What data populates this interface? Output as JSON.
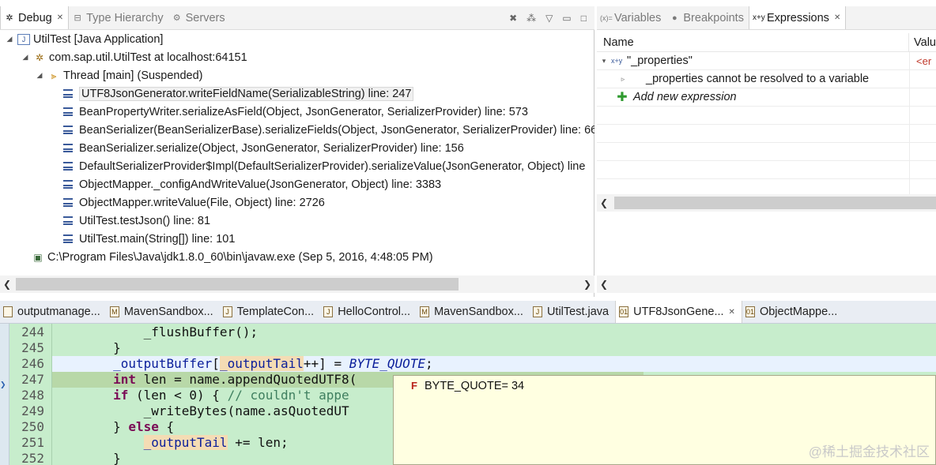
{
  "debug_view": {
    "tabs": [
      {
        "label": "Debug",
        "icon": "debug-bug-icon"
      },
      {
        "label": "Type Hierarchy",
        "icon": "type-hierarchy-icon"
      },
      {
        "label": "Servers",
        "icon": "servers-icon"
      }
    ],
    "tree": [
      {
        "label": "UtilTest [Java Application]",
        "level": 0,
        "icon": "java-application-icon",
        "expanded": true
      },
      {
        "label": "com.sap.util.UtilTest at localhost:64151",
        "level": 1,
        "icon": "debug-target-icon",
        "expanded": true
      },
      {
        "label": "Thread [main] (Suspended)",
        "level": 2,
        "icon": "suspended-thread-icon",
        "expanded": true
      },
      {
        "label": "UTF8JsonGenerator.writeFieldName(SerializableString) line: 247",
        "level": 3,
        "icon": "stack-frame-icon",
        "selected": true
      },
      {
        "label": "BeanPropertyWriter.serializeAsField(Object, JsonGenerator, SerializerProvider) line: 573",
        "level": 3,
        "icon": "stack-frame-icon"
      },
      {
        "label": "BeanSerializer(BeanSerializerBase).serializeFields(Object, JsonGenerator, SerializerProvider) line: 66",
        "level": 3,
        "icon": "stack-frame-icon"
      },
      {
        "label": "BeanSerializer.serialize(Object, JsonGenerator, SerializerProvider) line: 156",
        "level": 3,
        "icon": "stack-frame-icon"
      },
      {
        "label": "DefaultSerializerProvider$Impl(DefaultSerializerProvider).serializeValue(JsonGenerator, Object) line",
        "level": 3,
        "icon": "stack-frame-icon"
      },
      {
        "label": "ObjectMapper._configAndWriteValue(JsonGenerator, Object) line: 3383",
        "level": 3,
        "icon": "stack-frame-icon"
      },
      {
        "label": "ObjectMapper.writeValue(File, Object) line: 2726",
        "level": 3,
        "icon": "stack-frame-icon"
      },
      {
        "label": "UtilTest.testJson() line: 81",
        "level": 3,
        "icon": "stack-frame-icon"
      },
      {
        "label": "UtilTest.main(String[]) line: 101",
        "level": 3,
        "icon": "stack-frame-icon"
      },
      {
        "label": "C:\\Program Files\\Java\\jdk1.8.0_60\\bin\\javaw.exe (Sep 5, 2016, 4:48:05 PM)",
        "level": 1,
        "icon": "process-icon"
      }
    ]
  },
  "expr_view": {
    "tabs": [
      {
        "label": "Variables",
        "icon": "variables-icon"
      },
      {
        "label": "Breakpoints",
        "icon": "breakpoints-icon"
      },
      {
        "label": "Expressions",
        "icon": "expressions-icon"
      }
    ],
    "columns": {
      "name": "Name",
      "value": "Valu"
    },
    "rows": [
      {
        "name": "\"_properties\"",
        "value": "<er",
        "indent": 0,
        "toggle": "▾",
        "icon": "watch-expression-icon"
      },
      {
        "name": "_properties cannot be resolved to a variable",
        "value": "",
        "indent": 1,
        "toggle": "▹",
        "icon": ""
      },
      {
        "name": "Add new expression",
        "value": "",
        "indent": 0,
        "toggle": "",
        "icon": "add-plus-icon",
        "italic": true
      }
    ]
  },
  "editor": {
    "tabs": [
      {
        "label": "outputmanage..."
      },
      {
        "label": "MavenSandbox..."
      },
      {
        "label": "TemplateCon..."
      },
      {
        "label": "HelloControl..."
      },
      {
        "label": "MavenSandbox..."
      },
      {
        "label": "UtilTest.java"
      },
      {
        "label": "UTF8JsonGene...",
        "active": true
      },
      {
        "label": "ObjectMappe..."
      }
    ],
    "line_numbers": [
      "244",
      "245",
      "246",
      "247",
      "248",
      "249",
      "250",
      "251",
      "252"
    ],
    "lines": [
      "            _flushBuffer();",
      "        }",
      "        _outputBuffer[_outputTail++] = BYTE_QUOTE;",
      "        int len = name.appendQuotedUTF8(",
      "        if (len < 0) { // couldn't appe",
      "            _writeBytes(name.asQuotedUT",
      "        } else {",
      "            _outputTail += len;",
      "        }"
    ],
    "hover": {
      "text": "BYTE_QUOTE= 34",
      "icon": "static-field-icon"
    }
  },
  "watermark": "@稀土掘金技术社区"
}
